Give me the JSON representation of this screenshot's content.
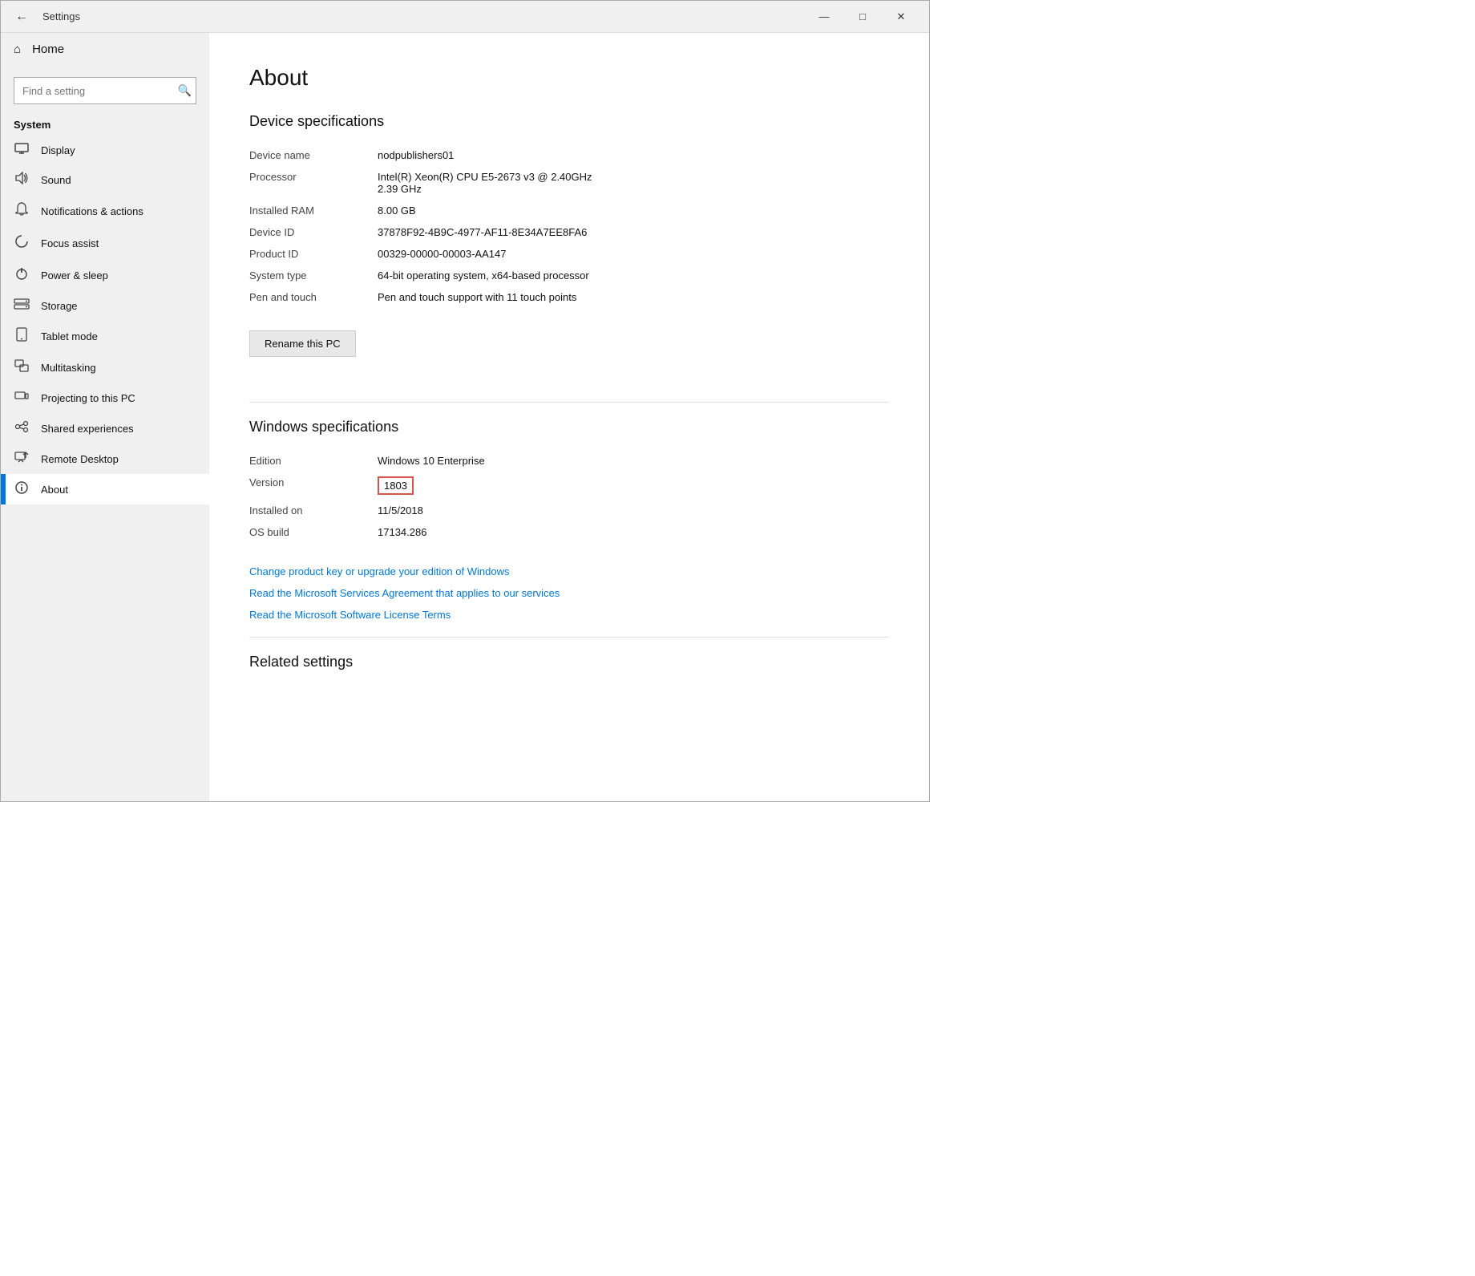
{
  "titlebar": {
    "title": "Settings",
    "back_label": "←",
    "minimize_label": "—",
    "maximize_label": "□",
    "close_label": "✕"
  },
  "sidebar": {
    "search_placeholder": "Find a setting",
    "search_icon": "🔍",
    "home_label": "Home",
    "home_icon": "⌂",
    "section_label": "System",
    "items": [
      {
        "id": "display",
        "label": "Display",
        "icon": "🖥"
      },
      {
        "id": "sound",
        "label": "Sound",
        "icon": "🔊"
      },
      {
        "id": "notifications",
        "label": "Notifications & actions",
        "icon": "🔔"
      },
      {
        "id": "focus",
        "label": "Focus assist",
        "icon": "☽"
      },
      {
        "id": "power",
        "label": "Power & sleep",
        "icon": "⏻"
      },
      {
        "id": "storage",
        "label": "Storage",
        "icon": "💾"
      },
      {
        "id": "tablet",
        "label": "Tablet mode",
        "icon": "⊡"
      },
      {
        "id": "multitasking",
        "label": "Multitasking",
        "icon": "⊞"
      },
      {
        "id": "projecting",
        "label": "Projecting to this PC",
        "icon": "⊟"
      },
      {
        "id": "shared",
        "label": "Shared experiences",
        "icon": "✕"
      },
      {
        "id": "remote",
        "label": "Remote Desktop",
        "icon": "↗"
      },
      {
        "id": "about",
        "label": "About",
        "icon": "ℹ"
      }
    ]
  },
  "content": {
    "page_title": "About",
    "device_section_title": "Device specifications",
    "specs": [
      {
        "label": "Device name",
        "value": "nodpublishers01"
      },
      {
        "label": "Processor",
        "value": "Intel(R) Xeon(R) CPU E5-2673 v3 @ 2.40GHz\n2.39 GHz"
      },
      {
        "label": "Installed RAM",
        "value": "8.00 GB"
      },
      {
        "label": "Device ID",
        "value": "37878F92-4B9C-4977-AF11-8E34A7EE8FA6"
      },
      {
        "label": "Product ID",
        "value": "00329-00000-00003-AA147"
      },
      {
        "label": "System type",
        "value": "64-bit operating system, x64-based processor"
      },
      {
        "label": "Pen and touch",
        "value": "Pen and touch support with 11 touch points"
      }
    ],
    "rename_button": "Rename this PC",
    "windows_section_title": "Windows specifications",
    "windows_specs": [
      {
        "label": "Edition",
        "value": "Windows 10 Enterprise",
        "highlight": false
      },
      {
        "label": "Version",
        "value": "1803",
        "highlight": true
      },
      {
        "label": "Installed on",
        "value": "11/5/2018",
        "highlight": false
      },
      {
        "label": "OS build",
        "value": "17134.286",
        "highlight": false
      }
    ],
    "links": [
      "Change product key or upgrade your edition of Windows",
      "Read the Microsoft Services Agreement that applies to our services",
      "Read the Microsoft Software License Terms"
    ],
    "related_section_title": "Related settings"
  }
}
